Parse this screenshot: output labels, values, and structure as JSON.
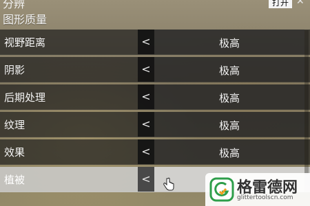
{
  "header": {
    "cut_label": "分辨",
    "toggle_label": "打开",
    "close_glyph": "✕"
  },
  "section": {
    "title": "图形质量"
  },
  "settings": [
    {
      "label": "视野距离",
      "arrow": "<",
      "value": "极高"
    },
    {
      "label": "阴影",
      "arrow": "<",
      "value": "极高"
    },
    {
      "label": "后期处理",
      "arrow": "<",
      "value": "极高"
    },
    {
      "label": "纹理",
      "arrow": "<",
      "value": "极高"
    },
    {
      "label": "效果",
      "arrow": "<",
      "value": "极高"
    },
    {
      "label": "植被",
      "arrow": "<",
      "value": ""
    }
  ],
  "selected_index": 5,
  "watermark": {
    "title": "格雷德网",
    "url": "glittertoolscn.com"
  },
  "colors": {
    "row_bg": "#1a1a1a",
    "selected_row_bg": "#cdcdcd",
    "text": "#f5f5f5",
    "watermark_green": "#2e9e4a"
  }
}
